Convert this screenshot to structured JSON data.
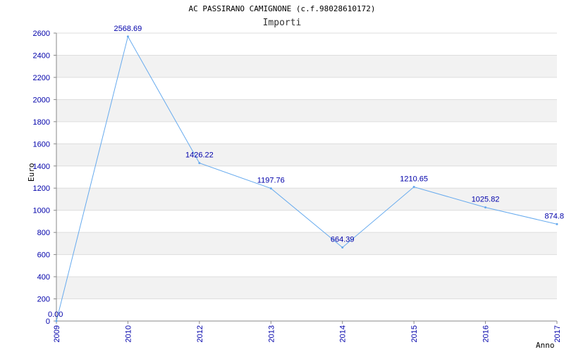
{
  "chart_data": {
    "type": "line",
    "title": "AC PASSIRANO CAMIGNONE (c.f.98028610172)",
    "subtitle": "Importi",
    "ylabel": "Euro",
    "xlabel": "Anno",
    "ylim": [
      0,
      2600
    ],
    "yticks": [
      0,
      200,
      400,
      600,
      800,
      1000,
      1200,
      1400,
      1600,
      1800,
      2000,
      2200,
      2400,
      2600
    ],
    "categories": [
      "2009",
      "2010",
      "2012",
      "2013",
      "2014",
      "2015",
      "2016",
      "2017"
    ],
    "series": [
      {
        "values": [
          0.0,
          2568.69,
          1426.22,
          1197.76,
          664.39,
          1210.65,
          1025.82,
          874.8
        ],
        "labels": [
          "0.00",
          "2568.69",
          "1426.22",
          "1197.76",
          "664.39",
          "1210.65",
          "1025.82",
          "874.8"
        ]
      }
    ],
    "grid": true,
    "colors": {
      "line": "#66aaee",
      "tick_text": "#0000aa",
      "band": "#f2f2f2",
      "grid": "#dddddd"
    }
  }
}
